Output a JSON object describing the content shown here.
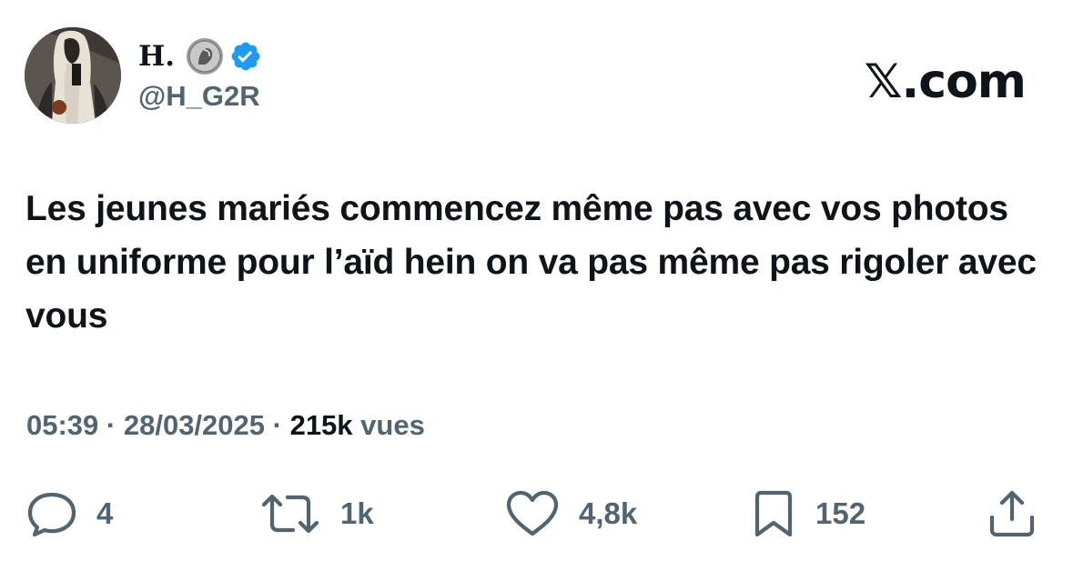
{
  "user": {
    "display_name": "H.",
    "handle": "@H_G2R",
    "badges": [
      "coin-icon",
      "verified-icon"
    ]
  },
  "site": {
    "label": "𝕏.com"
  },
  "tweet": {
    "text": "Les jeunes mariés commencez même pas avec vos photos en uniforme pour l’aïd hein on va pas même pas rigoler avec vous"
  },
  "meta": {
    "time": "05:39",
    "separator": " · ",
    "date": "28/03/2025",
    "views_count": "215k",
    "views_label": " vues"
  },
  "actions": {
    "replies": "4",
    "reposts": "1k",
    "likes": "4,8k",
    "bookmarks": "152"
  },
  "colors": {
    "text": "#0f1419",
    "secondary": "#536471",
    "verified": "#1d9bf0"
  }
}
